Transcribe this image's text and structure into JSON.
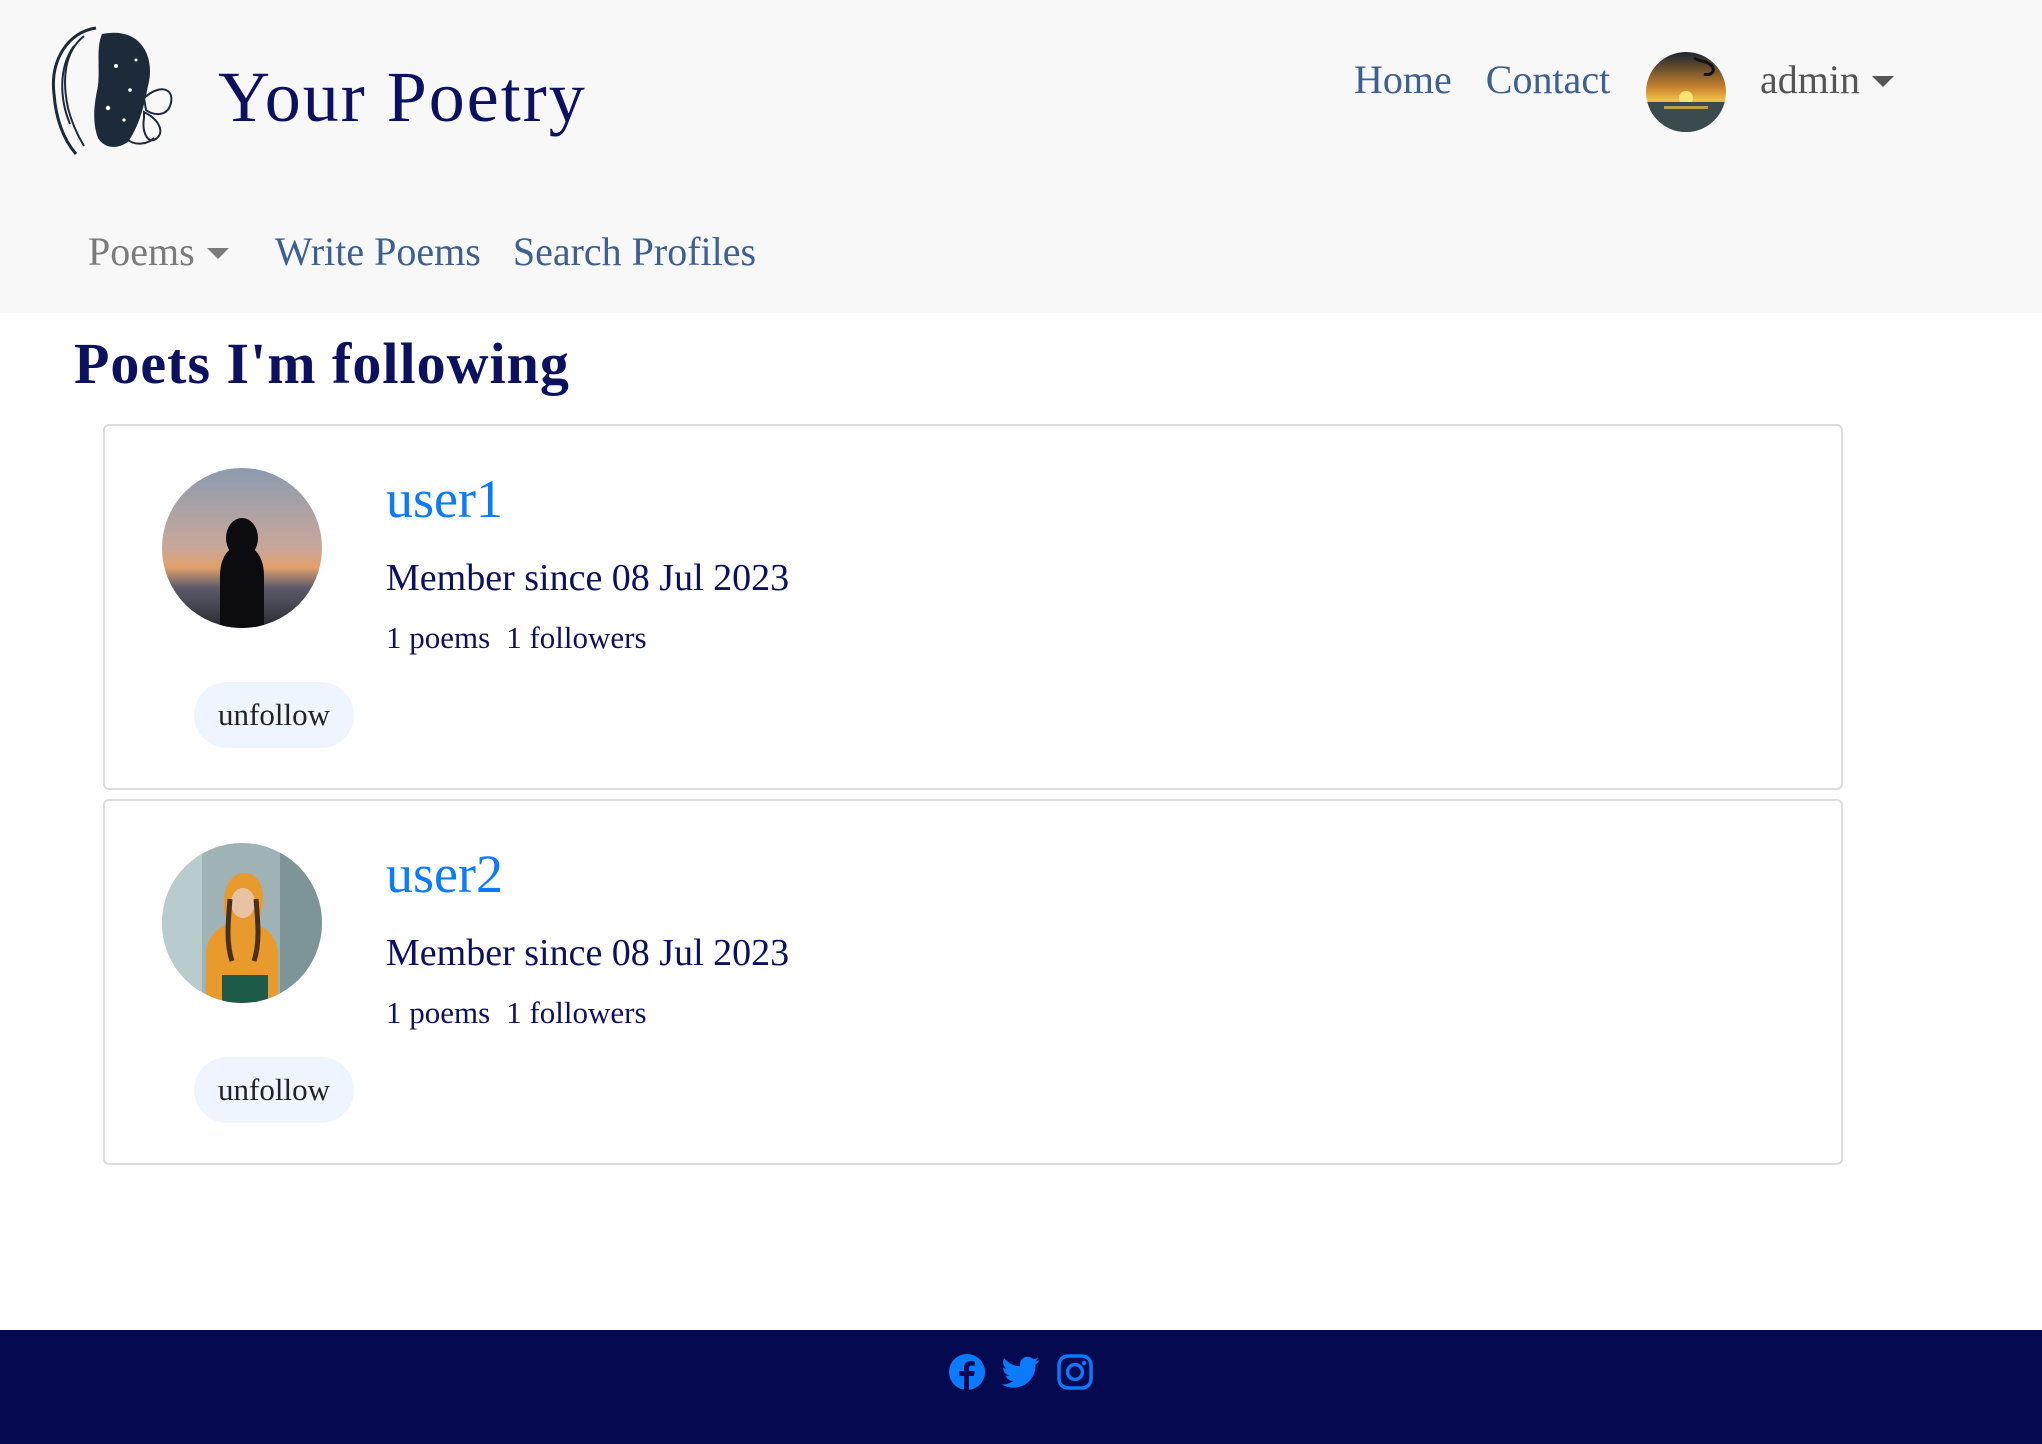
{
  "brand": {
    "name": "Your Poetry"
  },
  "top_nav": {
    "home": "Home",
    "contact": "Contact",
    "user": "admin"
  },
  "sub_nav": {
    "poems": "Poems",
    "write": "Write Poems",
    "search": "Search Profiles"
  },
  "page": {
    "title": "Poets I'm following"
  },
  "following": [
    {
      "username": "user1",
      "member_since": "Member since 08 Jul 2023",
      "poems": "1 poems",
      "followers": "1 followers",
      "action": "unfollow"
    },
    {
      "username": "user2",
      "member_since": "Member since 08 Jul 2023",
      "poems": "1 poems",
      "followers": "1 followers",
      "action": "unfollow"
    }
  ],
  "footer": {
    "icons": [
      "facebook-icon",
      "twitter-icon",
      "instagram-icon"
    ]
  },
  "colors": {
    "header_bg": "#f8f8f8",
    "brand_navy": "#0b1060",
    "link_blue": "#3d5f92",
    "accent_blue": "#0a7bff",
    "footer_bg": "#050a50",
    "button_bg": "#eef5ff"
  }
}
